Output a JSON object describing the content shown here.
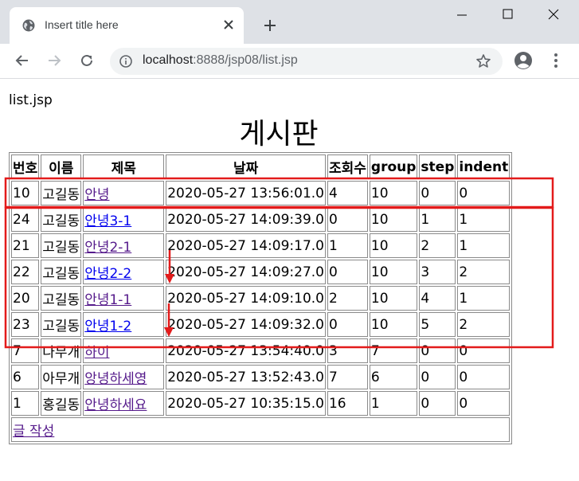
{
  "browser": {
    "tab_title": "Insert title here",
    "url_host": "localhost",
    "url_rest": ":8888/jsp08/list.jsp"
  },
  "page": {
    "file_label": "list.jsp",
    "title": "게시판",
    "write_link": "글 작성"
  },
  "table": {
    "headers": [
      "번호",
      "이름",
      "제목",
      "날짜",
      "조회수",
      "group",
      "step",
      "indent"
    ],
    "rows": [
      {
        "num": "10",
        "name": "고길동",
        "title": "안녕",
        "date": "2020-05-27 13:56:01.0",
        "hits": "4",
        "group": "10",
        "step": "0",
        "indent": "0",
        "visited": true
      },
      {
        "num": "24",
        "name": "고길동",
        "title": "안녕3-1",
        "date": "2020-05-27 14:09:39.0",
        "hits": "0",
        "group": "10",
        "step": "1",
        "indent": "1",
        "visited": false
      },
      {
        "num": "21",
        "name": "고길동",
        "title": "안녕2-1",
        "date": "2020-05-27 14:09:17.0",
        "hits": "1",
        "group": "10",
        "step": "2",
        "indent": "1",
        "visited": true
      },
      {
        "num": "22",
        "name": "고길동",
        "title": "안녕2-2",
        "date": "2020-05-27 14:09:27.0",
        "hits": "0",
        "group": "10",
        "step": "3",
        "indent": "2",
        "visited": false
      },
      {
        "num": "20",
        "name": "고길동",
        "title": "안녕1-1",
        "date": "2020-05-27 14:09:10.0",
        "hits": "2",
        "group": "10",
        "step": "4",
        "indent": "1",
        "visited": true
      },
      {
        "num": "23",
        "name": "고길동",
        "title": "안녕1-2",
        "date": "2020-05-27 14:09:32.0",
        "hits": "0",
        "group": "10",
        "step": "5",
        "indent": "2",
        "visited": false
      },
      {
        "num": "7",
        "name": "나무개",
        "title": "하이",
        "date": "2020-05-27 13:54:40.0",
        "hits": "3",
        "group": "7",
        "step": "0",
        "indent": "0",
        "visited": true
      },
      {
        "num": "6",
        "name": "아무개",
        "title": "앙녕하세영",
        "date": "2020-05-27 13:52:43.0",
        "hits": "7",
        "group": "6",
        "step": "0",
        "indent": "0",
        "visited": true
      },
      {
        "num": "1",
        "name": "홍길동",
        "title": "안녕하세요",
        "date": "2020-05-27 10:35:15.0",
        "hits": "16",
        "group": "1",
        "step": "0",
        "indent": "0",
        "visited": true
      }
    ]
  },
  "colors": {
    "annotation": "#e31b1b",
    "link": "#0000ee",
    "visited_link": "#551a8b"
  }
}
